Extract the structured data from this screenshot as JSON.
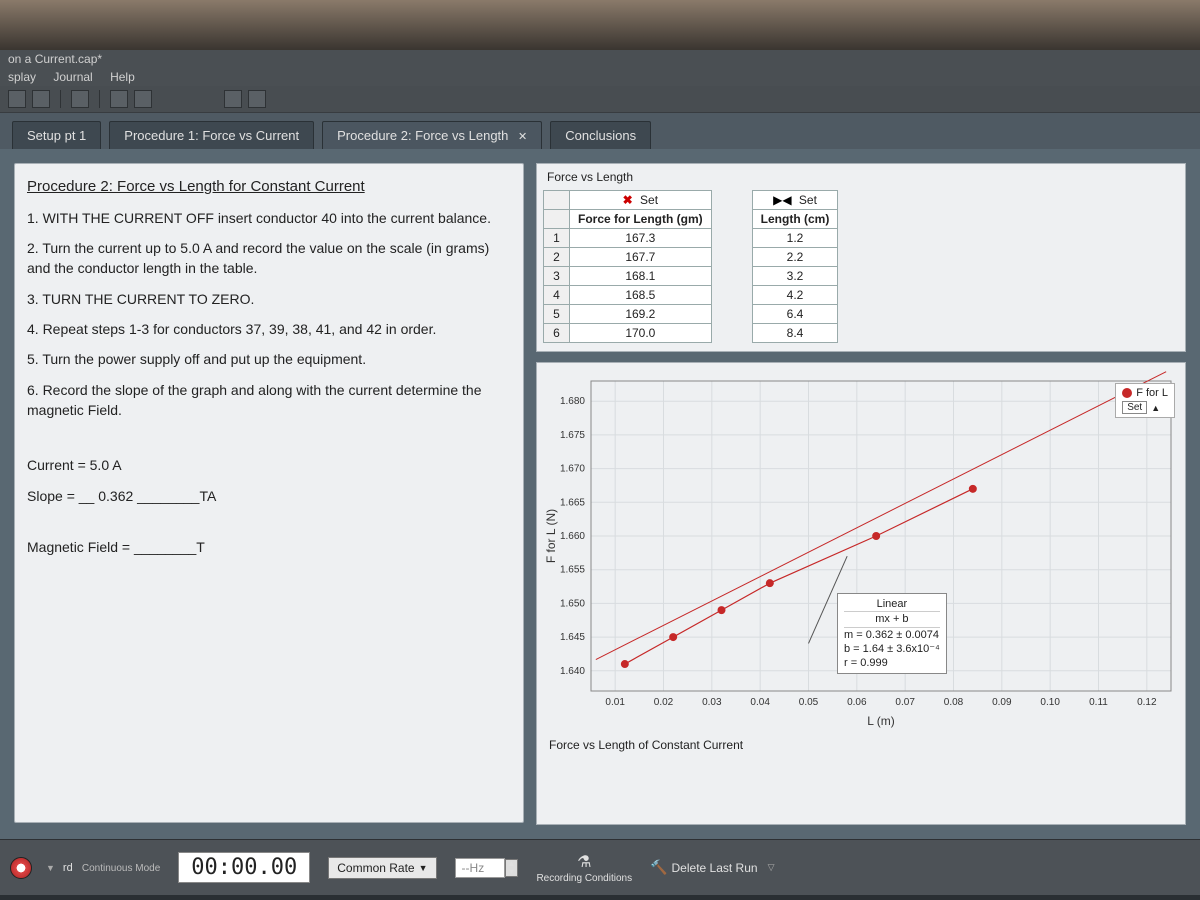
{
  "title_bar": "on a Current.cap*",
  "menu": {
    "m1": "splay",
    "m2": "Journal",
    "m3": "Help"
  },
  "tabs": {
    "t1": "Setup pt 1",
    "t2": "Procedure 1: Force vs Current",
    "t3": "Procedure 2: Force vs Length",
    "t4": "Conclusions"
  },
  "instructions": {
    "heading": "Procedure 2: Force vs Length for Constant Current",
    "s1": "1. WITH THE CURRENT OFF insert conductor 40 into the current balance.",
    "s2": "2. Turn the current up to 5.0 A and record the value on the scale (in grams) and the conductor length in the table.",
    "s3": "3. TURN THE CURRENT TO ZERO.",
    "s4": "4. Repeat steps 1-3 for conductors 37, 39, 38, 41, and 42 in order.",
    "s5": "5. Turn the power supply off and put up the equipment.",
    "s6": "6. Record the slope of the graph and along with the current determine the magnetic Field.",
    "current_label": "Current = ",
    "current_val": "5.0 A",
    "slope_label": "Slope = __",
    "slope_val": "0.362",
    "slope_unit": "________TA",
    "bfield_label": "Magnetic Field = ",
    "bfield_unit": "________T"
  },
  "table": {
    "title": "Force vs Length",
    "set_a": "Set",
    "set_b": "Set",
    "col_a": "Force for Length (gm)",
    "col_b": "Length (cm)",
    "rows": [
      {
        "n": "1",
        "a": "167.3",
        "b": "1.2"
      },
      {
        "n": "2",
        "a": "167.7",
        "b": "2.2"
      },
      {
        "n": "3",
        "a": "168.1",
        "b": "3.2"
      },
      {
        "n": "4",
        "a": "168.5",
        "b": "4.2"
      },
      {
        "n": "5",
        "a": "169.2",
        "b": "6.4"
      },
      {
        "n": "6",
        "a": "170.0",
        "b": "8.4"
      }
    ]
  },
  "chart_data": {
    "type": "scatter",
    "title": "Force vs Length of Constant Current",
    "xlabel": "L (m)",
    "ylabel": "F for L (N)",
    "xlim": [
      0.005,
      0.125
    ],
    "ylim": [
      1.637,
      1.683
    ],
    "xticks": [
      0.01,
      0.02,
      0.03,
      0.04,
      0.05,
      0.06,
      0.07,
      0.08,
      0.09,
      0.1,
      0.11,
      0.12
    ],
    "yticks": [
      1.64,
      1.645,
      1.65,
      1.655,
      1.66,
      1.665,
      1.67,
      1.675,
      1.68
    ],
    "series": [
      {
        "name": "F for L",
        "x": [
          0.012,
          0.022,
          0.032,
          0.042,
          0.064,
          0.084
        ],
        "y": [
          1.641,
          1.645,
          1.649,
          1.653,
          1.66,
          1.667
        ]
      }
    ],
    "fit": {
      "heading": "Linear",
      "eq": "mx + b",
      "m": "m = 0.362 ± 0.0074",
      "b": "b  = 1.64  ± 3.6x10⁻⁴",
      "r": "r = 0.999"
    },
    "legend": {
      "name": "F for L",
      "set": "Set"
    }
  },
  "bottom": {
    "rec_top": "rd",
    "rec_sub": "Continuous Mode",
    "timer": "00:00.00",
    "common_rate": "Common Rate",
    "hz": "--Hz",
    "rec_cond": "Recording Conditions",
    "delete_last": "Delete Last Run"
  }
}
